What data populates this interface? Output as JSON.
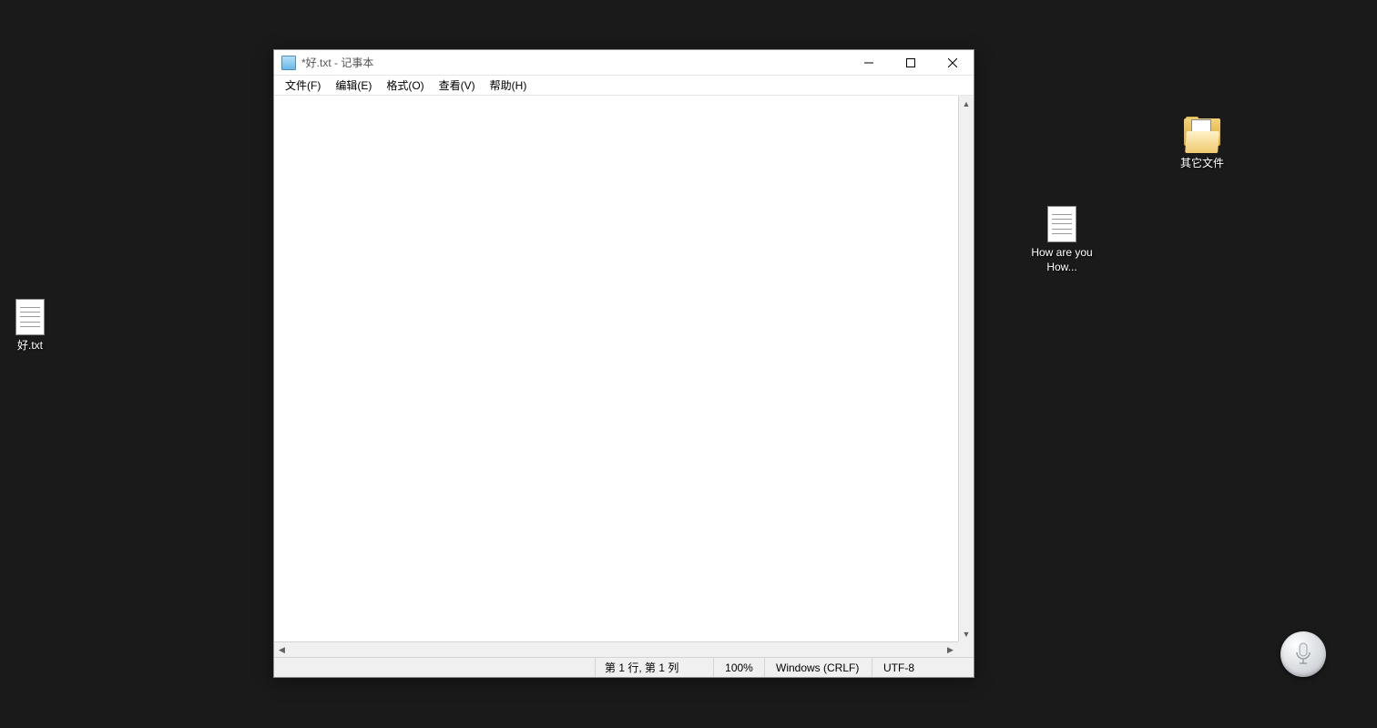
{
  "desktop": {
    "icons": [
      {
        "label": "好.txt",
        "type": "txt"
      },
      {
        "label": "其它文件",
        "type": "folder"
      },
      {
        "label": "How are you How...",
        "type": "txt"
      }
    ]
  },
  "notepad": {
    "title": "*好.txt - 记事本",
    "menu": {
      "file": "文件(F)",
      "edit": "编辑(E)",
      "format": "格式(O)",
      "view": "查看(V)",
      "help": "帮助(H)"
    },
    "content": "",
    "status": {
      "position": "第 1 行, 第 1 列",
      "zoom": "100%",
      "eol": "Windows (CRLF)",
      "encoding": "UTF-8"
    }
  }
}
